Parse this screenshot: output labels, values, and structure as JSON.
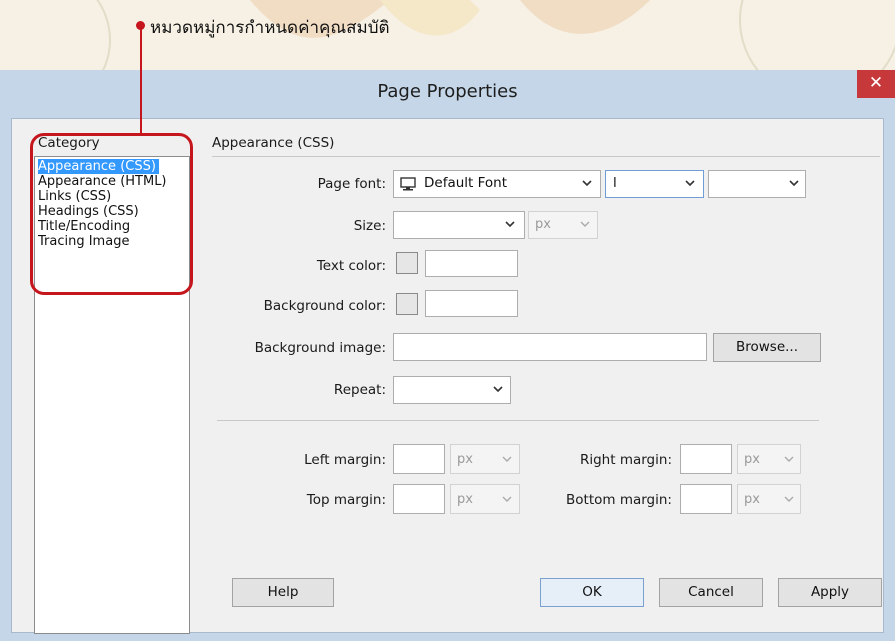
{
  "annotation": {
    "text": "หมวดหมู่การกำหนดค่าคุณสมบัติ"
  },
  "dialog": {
    "title": "Page Properties",
    "close_icon": "close-icon"
  },
  "category": {
    "header": "Category",
    "items": [
      "Appearance (CSS)",
      "Appearance (HTML)",
      "Links (CSS)",
      "Headings (CSS)",
      "Title/Encoding",
      "Tracing Image"
    ],
    "selected": "Appearance (CSS)"
  },
  "section": {
    "title": "Appearance (CSS)"
  },
  "form": {
    "page_font": {
      "label": "Page font:",
      "value": "Default Font",
      "style_value": "l",
      "weight_value": ""
    },
    "size": {
      "label": "Size:",
      "value": "",
      "unit": "px"
    },
    "text_color": {
      "label": "Text color:",
      "value": ""
    },
    "background_color": {
      "label": "Background color:",
      "value": ""
    },
    "background_image": {
      "label": "Background image:",
      "value": "",
      "browse": "Browse..."
    },
    "repeat": {
      "label": "Repeat:",
      "value": ""
    },
    "left_margin": {
      "label": "Left margin:",
      "value": "",
      "unit": "px"
    },
    "right_margin": {
      "label": "Right margin:",
      "value": "",
      "unit": "px"
    },
    "top_margin": {
      "label": "Top margin:",
      "value": "",
      "unit": "px"
    },
    "bottom_margin": {
      "label": "Bottom margin:",
      "value": "",
      "unit": "px"
    }
  },
  "buttons": {
    "help": "Help",
    "ok": "OK",
    "cancel": "Cancel",
    "apply": "Apply"
  },
  "colors": {
    "accent_red": "#c5161d",
    "selection_blue": "#3399ff",
    "close_red": "#c7383a"
  }
}
